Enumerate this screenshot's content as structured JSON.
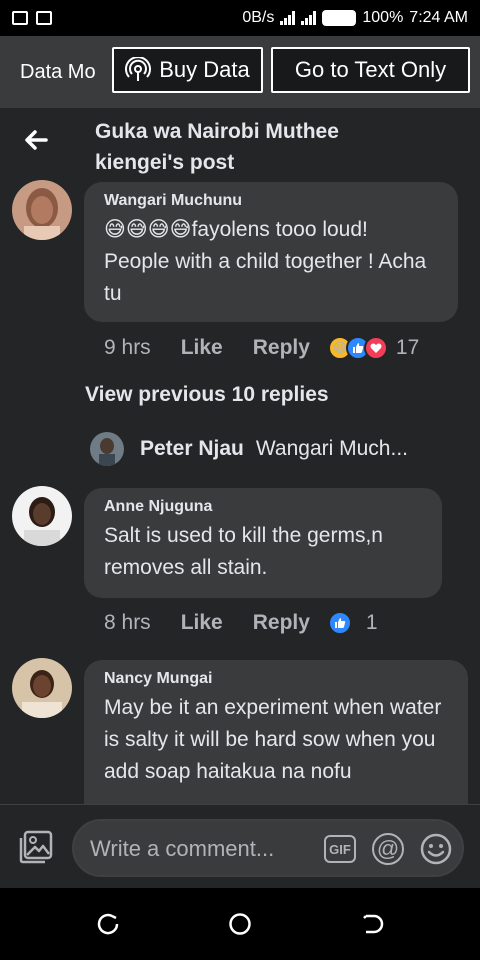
{
  "status": {
    "speed": "0B/s",
    "battery": "100%",
    "time": "7:24 AM"
  },
  "banner": {
    "mode_label": "Data Mo",
    "buy_label": "Buy Data",
    "text_only_label": "Go to Text Only"
  },
  "post": {
    "title_line1": "Guka wa Nairobi Muthee",
    "title_line2": "kiengei's post"
  },
  "comments": [
    {
      "name": "Wangari Muchunu",
      "emoji": "😅😅😅😅",
      "text": "fayolens tooo loud! People with a child together ! Acha tu",
      "time": "9 hrs",
      "like": "Like",
      "reply": "Reply",
      "reaction_count": "17"
    },
    {
      "name": "Anne Njuguna",
      "text": "Salt is used to kill the germs,n removes all stain.",
      "time": "8 hrs",
      "like": "Like",
      "reply": "Reply",
      "reaction_count": "1"
    },
    {
      "name": "Nancy Mungai",
      "text": "May be it an experiment  when water is salty it will  be hard sow when  you  add  soap haitakua na nofu"
    }
  ],
  "view_previous": "View previous 10 replies",
  "reply_preview": {
    "name": "Peter Njau",
    "text": "Wangari Much..."
  },
  "composer": {
    "placeholder": "Write a comment...",
    "gif": "GIF",
    "at": "@"
  },
  "colors": {
    "background": "#242526",
    "bubble": "#3a3b3c",
    "like_blue": "#2d88ff",
    "love_red": "#f33e58",
    "haha_yellow": "#f7b928"
  },
  "icons": [
    "back-arrow-icon",
    "broadcast-icon",
    "photo-icon",
    "gif-icon",
    "at-icon",
    "emoji-icon",
    "haha-icon",
    "like-icon",
    "love-icon",
    "recent-apps-icon",
    "home-icon",
    "back-nav-icon"
  ]
}
